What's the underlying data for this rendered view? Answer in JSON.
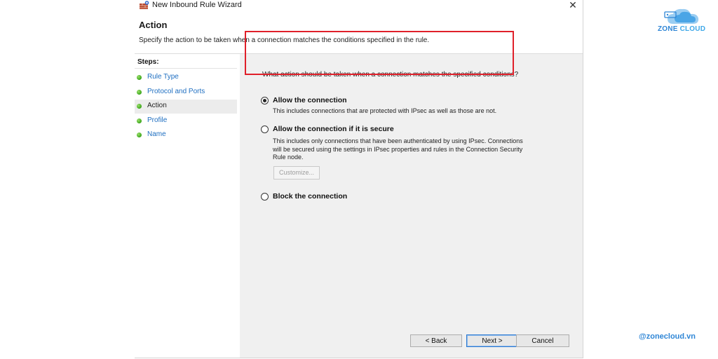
{
  "window": {
    "title": "New Inbound Rule Wizard",
    "close_glyph": "✕"
  },
  "header": {
    "title": "Action",
    "subtitle": "Specify the action to be taken when a connection matches the conditions specified in the rule."
  },
  "steps": {
    "title": "Steps:",
    "items": [
      {
        "label": "Rule Type",
        "current": false
      },
      {
        "label": "Protocol and Ports",
        "current": false
      },
      {
        "label": "Action",
        "current": true
      },
      {
        "label": "Profile",
        "current": false
      },
      {
        "label": "Name",
        "current": false
      }
    ]
  },
  "main": {
    "question": "What action should be taken when a connection matches the specified conditions?",
    "options": [
      {
        "label": "Allow the connection",
        "selected": true,
        "description_lines": [
          "This includes connections that are protected with IPsec as well as those are not."
        ]
      },
      {
        "label": "Allow the connection if it is secure",
        "selected": false,
        "description_lines": [
          "This includes only connections that have been authenticated by using IPsec.  Connections",
          "will be secured using the settings in IPsec properties and rules in the Connection Security",
          "Rule node."
        ]
      },
      {
        "label": "Block the connection",
        "selected": false,
        "description_lines": []
      }
    ],
    "customize_label": "Customize..."
  },
  "buttons": {
    "back": "< Back",
    "next": "Next >",
    "cancel": "Cancel"
  },
  "branding": {
    "logo_text_a": "ZONE",
    "logo_text_b": "CLOUD",
    "handle": "@zonecloud.vn"
  },
  "colors": {
    "highlight": "#e0202a",
    "link": "#1f6fc1",
    "step_dot": "#3aa51a",
    "brand": "#2f86d6"
  }
}
